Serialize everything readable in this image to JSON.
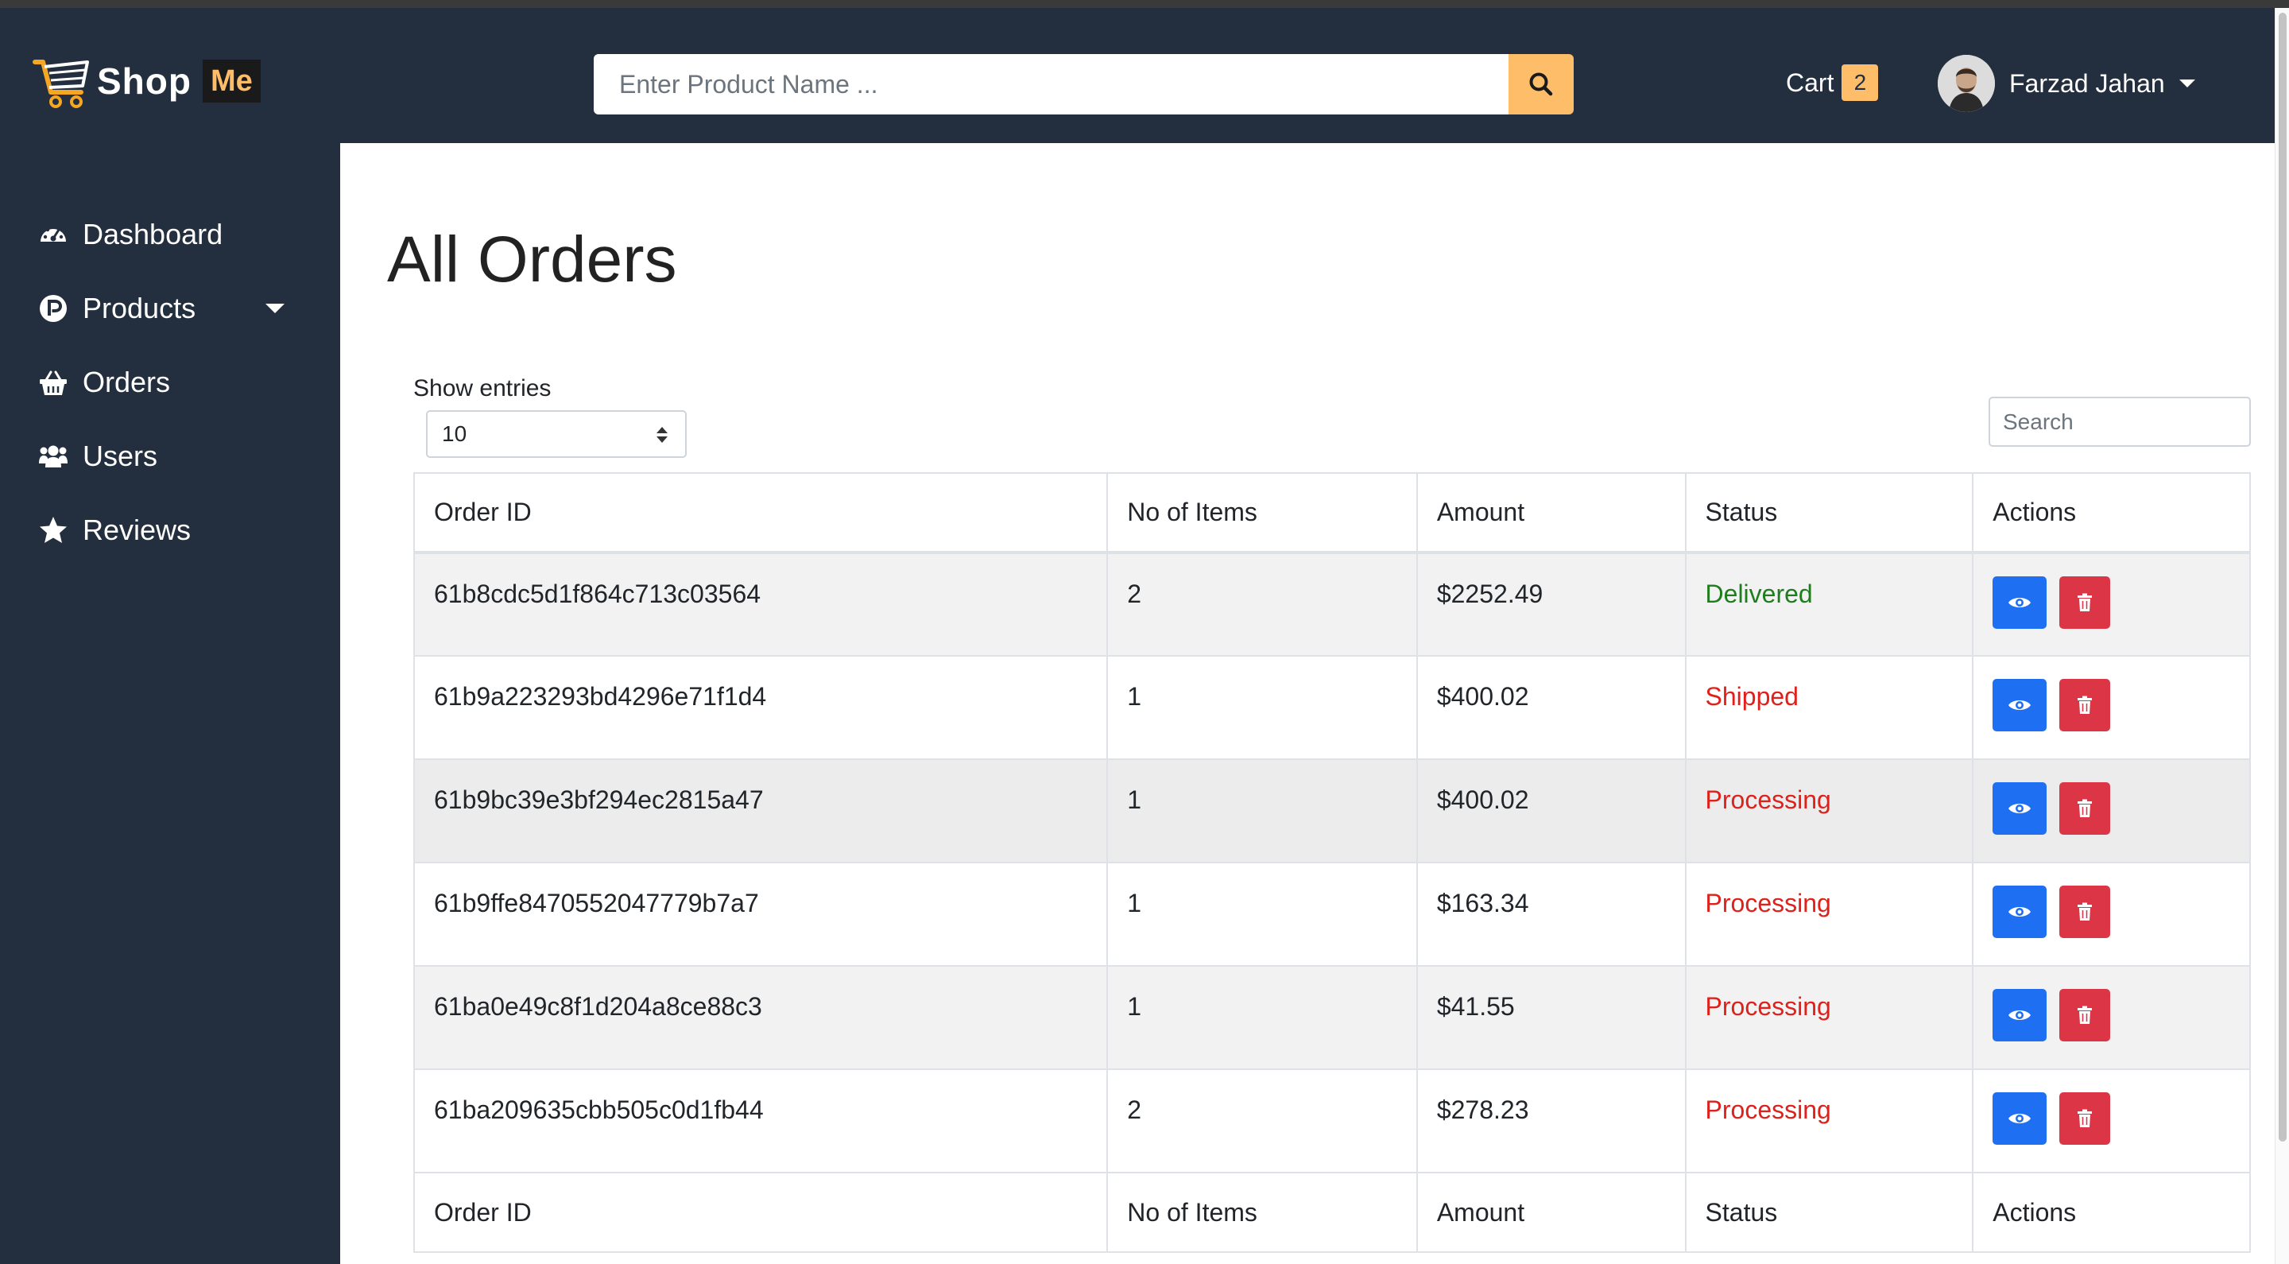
{
  "brand": {
    "name": "Shop",
    "suffix": "Me"
  },
  "search": {
    "placeholder": "Enter Product Name ..."
  },
  "cart": {
    "label": "Cart",
    "count": "2"
  },
  "user": {
    "name": "Farzad Jahan"
  },
  "sidebar": {
    "items": [
      {
        "label": "Dashboard",
        "icon": "tachometer-icon"
      },
      {
        "label": "Products",
        "icon": "product-p-icon"
      },
      {
        "label": "Orders",
        "icon": "shopping-basket-icon"
      },
      {
        "label": "Users",
        "icon": "users-icon"
      },
      {
        "label": "Reviews",
        "icon": "star-icon"
      }
    ]
  },
  "page": {
    "title": "All Orders"
  },
  "entries": {
    "label": "Show entries",
    "value": "10"
  },
  "table_search": {
    "placeholder": "Search"
  },
  "table": {
    "columns": [
      "Order ID",
      "No of Items",
      "Amount",
      "Status",
      "Actions"
    ],
    "rows": [
      {
        "id": "61b8cdc5d1f864c713c03564",
        "items": "2",
        "amount": "$2252.49",
        "status": "Delivered"
      },
      {
        "id": "61b9a223293bd4296e71f1d4",
        "items": "1",
        "amount": "$400.02",
        "status": "Shipped"
      },
      {
        "id": "61b9bc39e3bf294ec2815a47",
        "items": "1",
        "amount": "$400.02",
        "status": "Processing"
      },
      {
        "id": "61b9ffe8470552047779b7a7",
        "items": "1",
        "amount": "$163.34",
        "status": "Processing"
      },
      {
        "id": "61ba0e49c8f1d204a8ce88c3",
        "items": "1",
        "amount": "$41.55",
        "status": "Processing"
      },
      {
        "id": "61ba209635cbb505c0d1fb44",
        "items": "2",
        "amount": "$278.23",
        "status": "Processing"
      }
    ]
  },
  "colors": {
    "navbar": "#232f3e",
    "accent": "#febd69",
    "view_button": "#1e6ff1",
    "delete_button": "#dc3545",
    "delivered": "#1e7e1e",
    "pending": "#e0201a"
  }
}
